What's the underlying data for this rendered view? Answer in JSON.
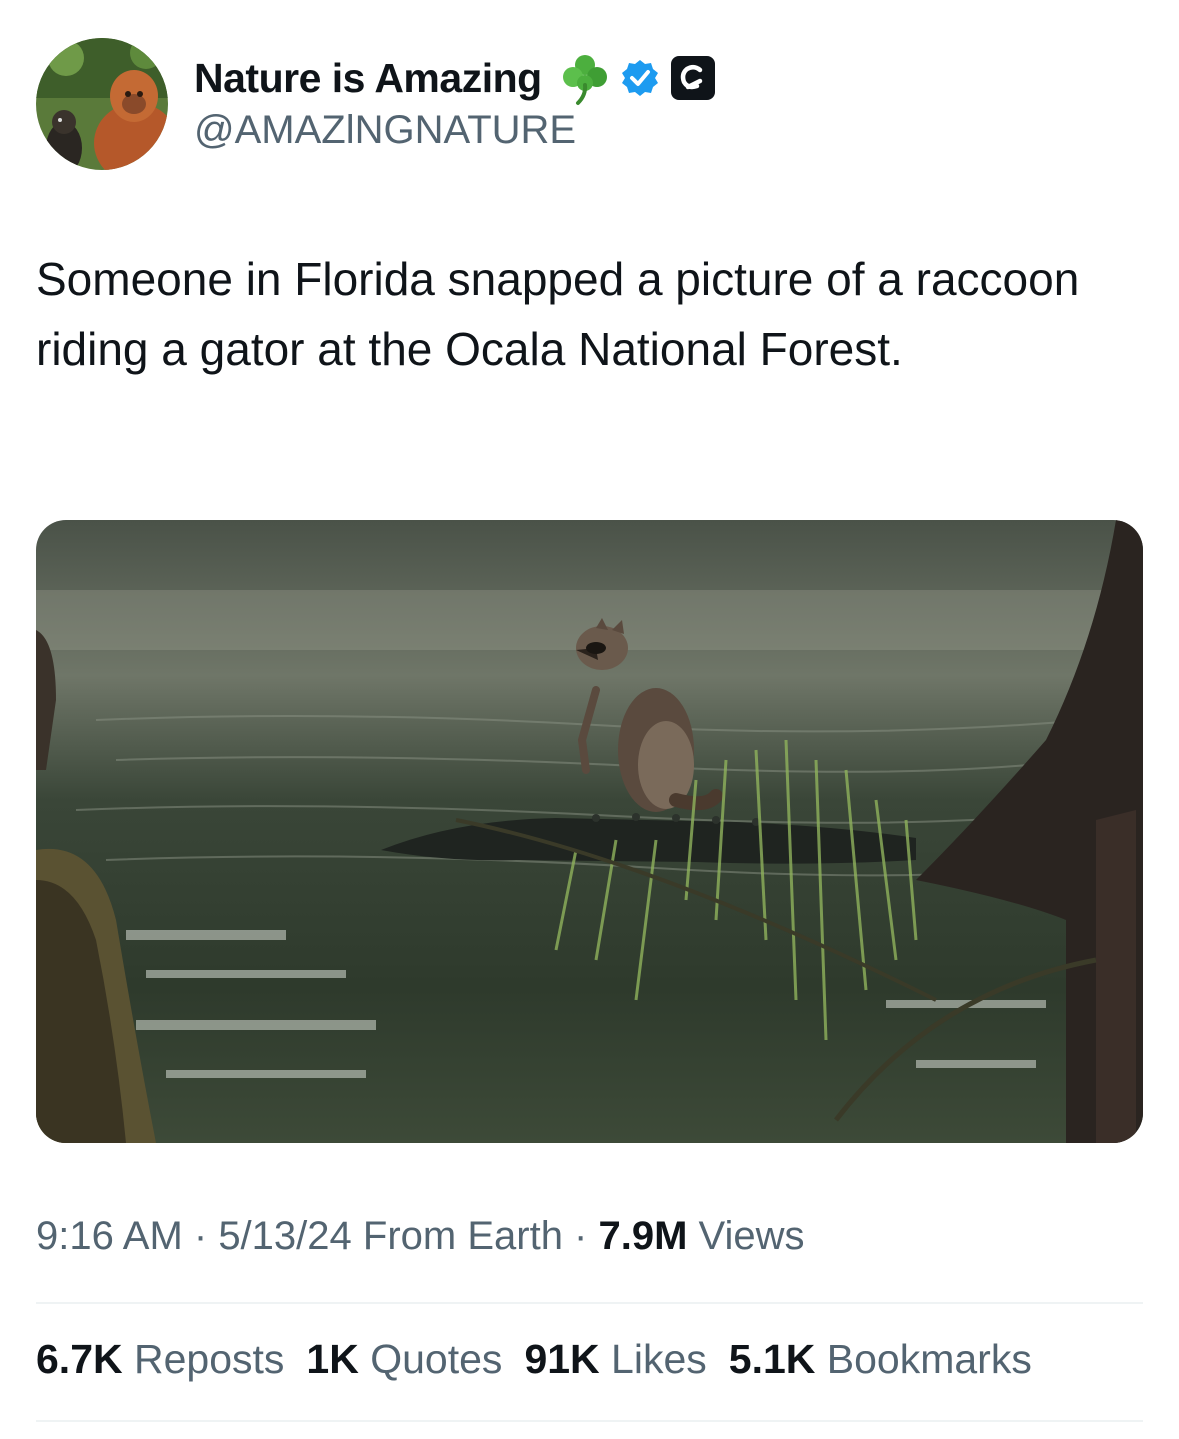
{
  "author": {
    "name": "Nature is Amazing",
    "handle": "@AMAZlNGNATURE",
    "verified_color": "#1d9bf0"
  },
  "tweet": {
    "text": "Someone in Florida snapped a picture of a raccoon riding a gator at the Ocala National Forest."
  },
  "meta": {
    "time": "9:16 AM",
    "sep1": " · ",
    "date": "5/13/24",
    "source": " From Earth",
    "sep2": " · ",
    "views_count": "7.9M",
    "views_label": " Views"
  },
  "stats": {
    "reposts_count": "6.7K",
    "reposts_label": " Reposts",
    "quotes_count": "1K",
    "quotes_label": " Quotes",
    "likes_count": "91K",
    "likes_label": " Likes",
    "bookmarks_count": "5.1K",
    "bookmarks_label": " Bookmarks"
  },
  "icons": {
    "avatar": "orangutan-avatar",
    "clover": "shamrock-icon",
    "verified": "verified-badge-icon",
    "affiliate": "affiliate-c-icon"
  },
  "colors": {
    "text_primary": "#0f1419",
    "text_secondary": "#536471",
    "divider": "#eff3f4"
  }
}
